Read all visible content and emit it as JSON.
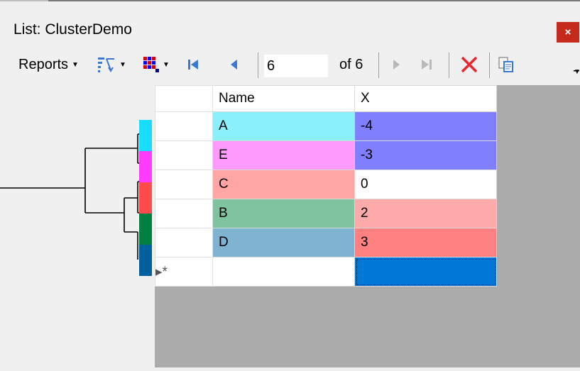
{
  "window": {
    "title": "List: ClusterDemo",
    "close_label": "×"
  },
  "toolbar": {
    "reports_label": "Reports",
    "position_value": "6",
    "of_label": "of 6"
  },
  "grid": {
    "columns": [
      "Name",
      "X"
    ],
    "rows": [
      {
        "name": "A",
        "x": "-4",
        "name_color": "#8af0fc",
        "x_color": "#8080ff"
      },
      {
        "name": "E",
        "x": "-3",
        "name_color": "#ff9aff",
        "x_color": "#8080ff"
      },
      {
        "name": "C",
        "x": "0",
        "name_color": "#ffa5a5",
        "x_color": "#ffffff"
      },
      {
        "name": "B",
        "x": "2",
        "name_color": "#80c3a0",
        "x_color": "#ffaaaa"
      },
      {
        "name": "D",
        "x": "3",
        "name_color": "#80b3d2",
        "x_color": "#ff8080"
      }
    ],
    "new_row_marker": "▸*"
  },
  "dendrogram": {
    "leaf_colors": [
      "#19dcff",
      "#ff3cff",
      "#ff4b4b",
      "#008040",
      "#0060a0"
    ]
  }
}
